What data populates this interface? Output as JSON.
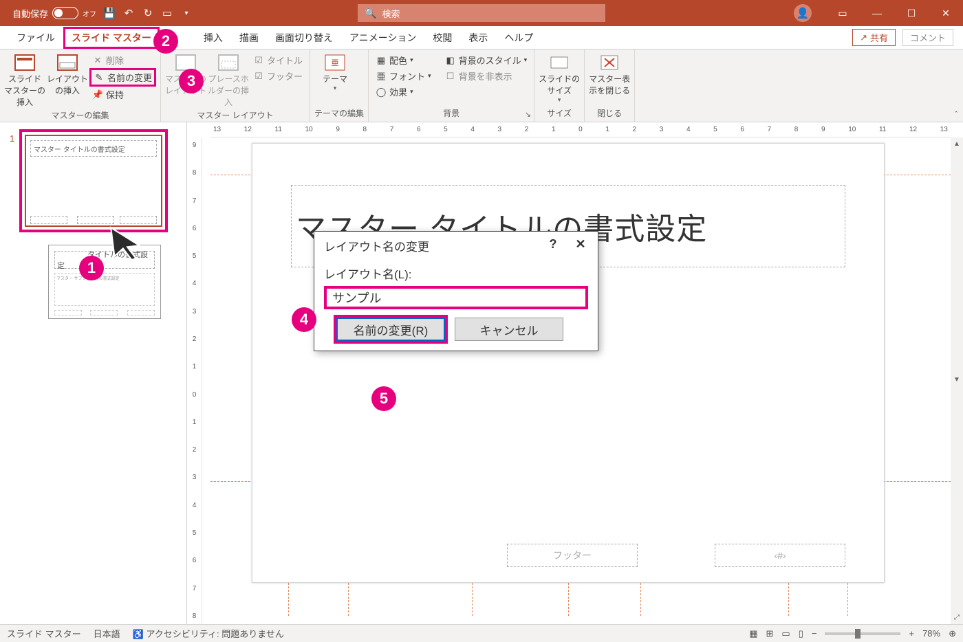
{
  "titlebar": {
    "autosave_label": "自動保存",
    "autosave_state": "オフ",
    "search_placeholder": "検索"
  },
  "tabs": {
    "file": "ファイル",
    "slide_master": "スライド マスター",
    "insert": "挿入",
    "draw": "描画",
    "transitions": "画面切り替え",
    "animations": "アニメーション",
    "review": "校閲",
    "view": "表示",
    "help": "ヘルプ",
    "share": "共有",
    "comments": "コメント"
  },
  "ribbon": {
    "insert_master": "スライド マスターの挿入",
    "insert_layout": "レイアウトの挿入",
    "delete": "削除",
    "rename": "名前の変更",
    "preserve": "保持",
    "group_edit": "マスターの編集",
    "master_layout": "マスターのレイアウト",
    "insert_placeholder": "プレースホルダーの挿入",
    "title_cb": "タイトル",
    "footer_cb": "フッター",
    "group_layout": "マスター レイアウト",
    "themes": "テーマ",
    "group_theme": "テーマの編集",
    "colors": "配色",
    "fonts": "フォント",
    "effects": "効果",
    "bg_styles": "背景のスタイル",
    "hide_bg": "背景を非表示",
    "group_bg": "背景",
    "slide_size": "スライドのサイズ",
    "group_size": "サイズ",
    "close_master": "マスター表示を閉じる",
    "group_close": "閉じる"
  },
  "thumbs": {
    "num": "1",
    "master_title": "マスター タイトルの書式設定",
    "layout_title": "　　　　タイトルの書式設定"
  },
  "canvas": {
    "title_text": "マスター タイトルの書式設定",
    "footer_text": "フッター",
    "pagenum_text": "‹#›"
  },
  "dialog": {
    "title": "レイアウト名の変更",
    "label": "レイアウト名(L):",
    "value": "サンプル",
    "rename_btn": "名前の変更(R)",
    "cancel_btn": "キャンセル"
  },
  "ruler": {
    "ticks_h": [
      "13",
      "12",
      "11",
      "10",
      "9",
      "8",
      "7",
      "6",
      "5",
      "4",
      "3",
      "2",
      "1",
      "0",
      "1",
      "2",
      "3",
      "4",
      "5",
      "6",
      "7",
      "8",
      "9",
      "10",
      "11",
      "12",
      "13"
    ],
    "ticks_v": [
      "9",
      "8",
      "7",
      "6",
      "5",
      "4",
      "3",
      "2",
      "1",
      "0",
      "1",
      "2",
      "3",
      "4",
      "5",
      "6",
      "7",
      "8"
    ]
  },
  "statusbar": {
    "mode": "スライド マスター",
    "lang": "日本語",
    "a11y": "アクセシビリティ: 問題ありません",
    "zoom": "78%"
  },
  "badges": [
    "1",
    "2",
    "3",
    "4",
    "5"
  ]
}
